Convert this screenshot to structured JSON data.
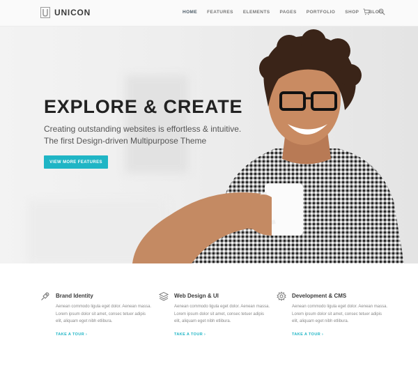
{
  "brand": {
    "name": "UNICON",
    "logo_icon": "u-logo-icon"
  },
  "nav": {
    "items": [
      {
        "label": "HOME",
        "active": true
      },
      {
        "label": "FEATURES",
        "active": false
      },
      {
        "label": "ELEMENTS",
        "active": false
      },
      {
        "label": "PAGES",
        "active": false
      },
      {
        "label": "PORTFOLIO",
        "active": false
      },
      {
        "label": "SHOP",
        "active": false
      },
      {
        "label": "BLOG",
        "active": false
      }
    ],
    "icons": [
      "cart-icon",
      "search-icon"
    ]
  },
  "hero": {
    "title": "EXPLORE & CREATE",
    "subtitle_line1": "Creating outstanding websites is effortless & intuitive.",
    "subtitle_line2": "The first Design-driven Multipurpose Theme",
    "button_label": "VIEW MORE FEATURES"
  },
  "features": [
    {
      "icon": "rocket-icon",
      "title": "Brand Identity",
      "description": "Aenean commodo ligula eget dolor. Aenean massa. Lorem ipsum dolor sit amet, consec tetuer adipis elit, aliquam eget nibh etlibura.",
      "link": "TAKE A TOUR"
    },
    {
      "icon": "layers-icon",
      "title": "Web Design & UI",
      "description": "Aenean commodo ligula eget dolor. Aenean massa. Lorem ipsum dolor sit amet, consec tetuer adipis elit, aliquam eget nibh etlibura.",
      "link": "TAKE A TOUR"
    },
    {
      "icon": "gear-icon",
      "title": "Development & CMS",
      "description": "Aenean commodo ligula eget dolor. Aenean massa. Lorem ipsum dolor sit amet, consec tetuer adipis elit, aliquam eget nibh etlibura.",
      "link": "TAKE A TOUR"
    }
  ],
  "colors": {
    "accent": "#1fb5c5",
    "heading": "#222222",
    "body_text": "#888888"
  }
}
